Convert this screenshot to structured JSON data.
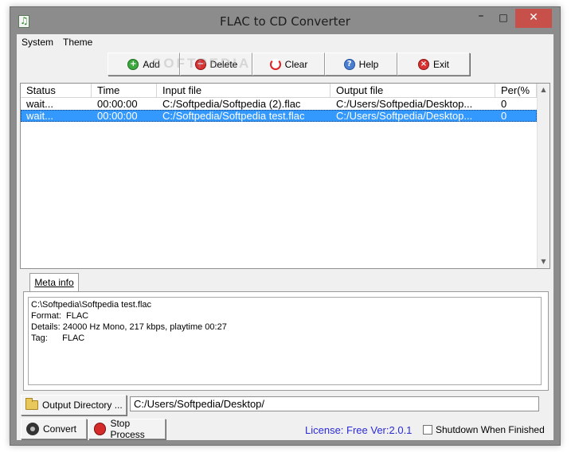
{
  "window": {
    "title": "FLAC to CD Converter",
    "controls": {
      "minimize": "–",
      "maximize": "□",
      "close": "✕"
    }
  },
  "menu": [
    "System",
    "Theme"
  ],
  "toolbar": {
    "watermark": "SOFTPEDIA",
    "buttons": [
      {
        "label": "Add",
        "icon": "add-icon"
      },
      {
        "label": "Delete",
        "icon": "delete-icon"
      },
      {
        "label": "Clear",
        "icon": "clear-icon"
      },
      {
        "label": "Help",
        "icon": "help-icon"
      },
      {
        "label": "Exit",
        "icon": "exit-icon"
      }
    ]
  },
  "file_list": {
    "columns": [
      "Status",
      "Time",
      "Input file",
      "Output file",
      "Per(%"
    ],
    "rows": [
      {
        "status": "wait...",
        "time": "00:00:00",
        "input": "C:/Softpedia/Softpedia (2).flac",
        "output": "C:/Users/Softpedia/Desktop...",
        "percent": "0",
        "selected": false
      },
      {
        "status": "wait...",
        "time": "00:00:00",
        "input": "C:/Softpedia/Softpedia test.flac",
        "output": "C:/Users/Softpedia/Desktop...",
        "percent": "0",
        "selected": true
      }
    ]
  },
  "meta": {
    "tab_label": "Meta info",
    "lines": [
      "C:\\Softpedia\\Softpedia test.flac",
      "Format:  FLAC",
      "Details: 24000 Hz Mono, 217 kbps, playtime 00:27",
      "Tag:      FLAC"
    ]
  },
  "output": {
    "button_label": "Output Directory ...",
    "path": "C:/Users/Softpedia/Desktop/"
  },
  "actions": {
    "convert_label": "Convert",
    "stop_label": "Stop Process"
  },
  "status": {
    "license": "License: Free Ver:2.0.1",
    "shutdown_label": "Shutdown When Finished",
    "shutdown_checked": false
  },
  "colors": {
    "accent": "#3399ff",
    "close": "#c7504b",
    "license": "#2b2bd6"
  }
}
